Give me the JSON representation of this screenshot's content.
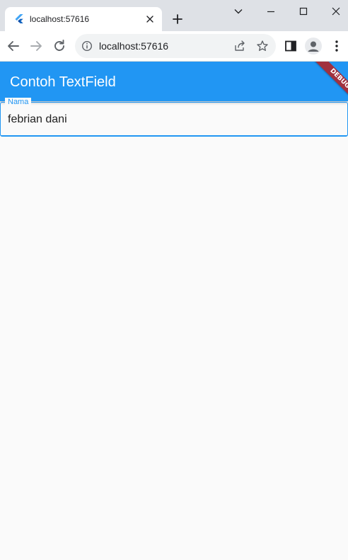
{
  "browser": {
    "tab": {
      "title": "localhost:57616"
    },
    "address_bar": {
      "url": "localhost:57616"
    }
  },
  "app": {
    "app_bar": {
      "title": "Contoh TextField"
    },
    "debug_banner": {
      "label": "DEBUG"
    },
    "text_field": {
      "label": "Nama",
      "value": "febrian dani"
    }
  },
  "colors": {
    "primary": "#2196f3",
    "debug_banner": "#a1313f",
    "background": "#fafafa",
    "titlebar": "#dee1e6"
  }
}
